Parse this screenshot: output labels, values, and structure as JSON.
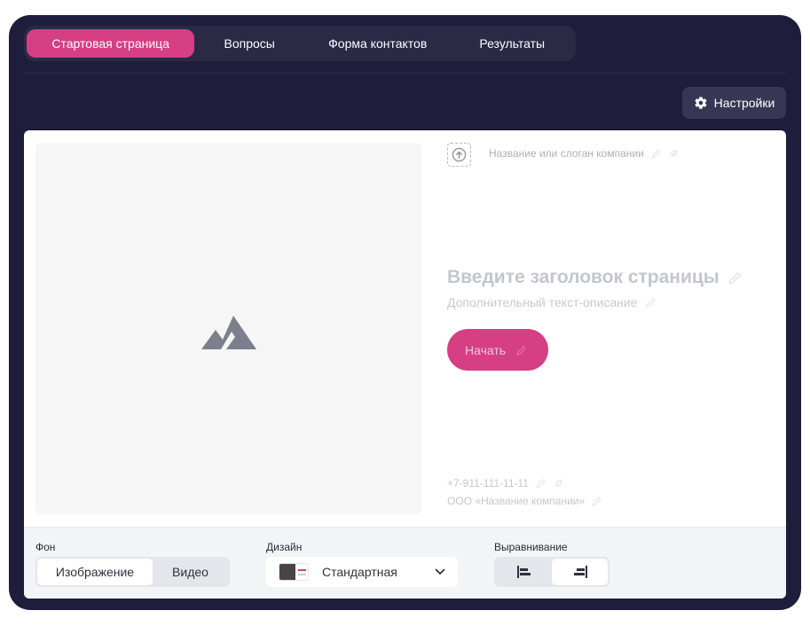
{
  "tabs": [
    {
      "label": "Стартовая страница",
      "active": true
    },
    {
      "label": "Вопросы",
      "active": false
    },
    {
      "label": "Форма контактов",
      "active": false
    },
    {
      "label": "Результаты",
      "active": false
    }
  ],
  "settings": {
    "label": "Настройки",
    "icon": "gear-icon"
  },
  "preview": {
    "media_icon": "image-placeholder-icon",
    "logo_icon": "upload-icon",
    "slogan_placeholder": "Название или слоган компании",
    "headline_placeholder": "Введите заголовок страницы",
    "subtitle_placeholder": "Дополнительный текст-описание",
    "start_button": "Начать",
    "phone": "+7-911-111-11-11",
    "company": "ООО «Название компании»"
  },
  "toolbar": {
    "background": {
      "label": "Фон",
      "options": [
        {
          "label": "Изображение",
          "active": true
        },
        {
          "label": "Видео",
          "active": false
        }
      ]
    },
    "design": {
      "label": "Дизайн",
      "value": "Стандартная"
    },
    "alignment": {
      "label": "Выравнивание",
      "options": [
        {
          "icon": "align-left-icon",
          "active": false
        },
        {
          "icon": "align-right-icon",
          "active": true
        }
      ]
    }
  },
  "colors": {
    "accent": "#d63f84",
    "frame": "#1e1d3b",
    "tab_bar": "#2a2946",
    "settings_bg": "#383753"
  }
}
